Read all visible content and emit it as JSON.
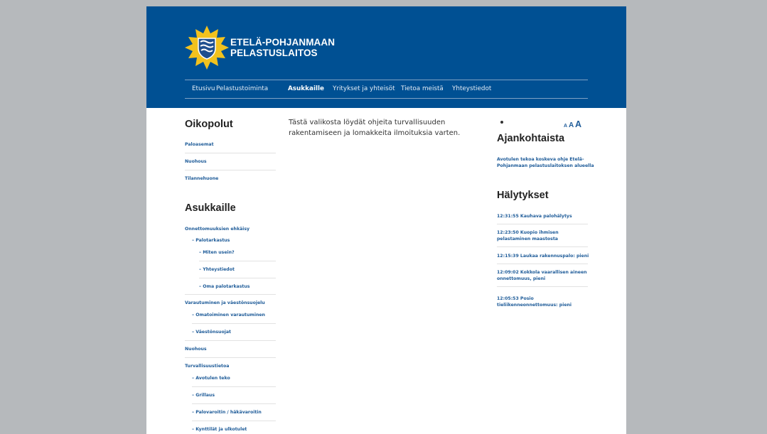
{
  "site": {
    "logo_line1": "ETELÄ-POHJANMAAN",
    "logo_line2": "PELASTUSLAITOS",
    "colors": {
      "header": "#005093",
      "link": "#1f5c99",
      "emblem": "#f2c21e"
    },
    "logo_icon": "coat-of-arms-emblem"
  },
  "nav": {
    "items": [
      {
        "label": "Etusivu"
      },
      {
        "label": "Pelastustoiminta"
      },
      {
        "label": "Asukkaille",
        "active": true
      },
      {
        "label": "Yritykset ja yhteisöt"
      },
      {
        "label": "Tietoa meistä"
      },
      {
        "label": "Yhteystiedot"
      }
    ]
  },
  "oikopolut": {
    "title": "Oikopolut",
    "items": [
      {
        "label": "Paloasemat"
      },
      {
        "label": "Nuohous"
      },
      {
        "label": "Tilannehuone"
      }
    ]
  },
  "asukkaille": {
    "title": "Asukkaille",
    "items": [
      {
        "label": "Onnettomuuksien ehkäisy"
      },
      {
        "label": "– Palotarkastus"
      },
      {
        "label": "– Miten usein?"
      },
      {
        "label": "– Yhteystiedot"
      },
      {
        "label": "– Oma palotarkastus"
      },
      {
        "label": "Varautuminen ja väestönsuojelu"
      },
      {
        "label": "– Omatoiminen varautuminen"
      },
      {
        "label": "– Väestönsuojat"
      },
      {
        "label": "Nuohous"
      },
      {
        "label": "Turvallisuustietoa"
      },
      {
        "label": "– Avotulen teko"
      },
      {
        "label": "– Grillaus"
      },
      {
        "label": "– Palovaroitin / häkävaroitin"
      },
      {
        "label": "– Kynttilät ja ulkotulet"
      }
    ]
  },
  "main": {
    "intro": "Tästä valikosta löydät ohjeita turvallisuuden rakentamiseen ja lomakkeita ilmoituksia varten."
  },
  "font_size": {
    "small": "A",
    "medium": "A",
    "large": "A"
  },
  "ajankohtaista": {
    "title": "Ajankohtaista",
    "items": [
      {
        "label": "Avotulen tekoa koskeva ohje Etelä-Pohjanmaan pelastuslaitoksen alueella"
      }
    ]
  },
  "halytykset": {
    "title": "Hälytykset",
    "items": [
      {
        "label": "12:31:55 Kauhava palohälytys"
      },
      {
        "label": "12:23:50 Kuopio ihmisen pelastaminen maastosta"
      },
      {
        "label": "12:15:39 Laukaa rakennuspalo: pieni"
      },
      {
        "label": "12:09:02 Kokkola vaarallisen aineen onnettomuus, pieni"
      },
      {
        "label": "12:05:53 Posio tieliikenneonnettomuus: pieni"
      }
    ]
  }
}
